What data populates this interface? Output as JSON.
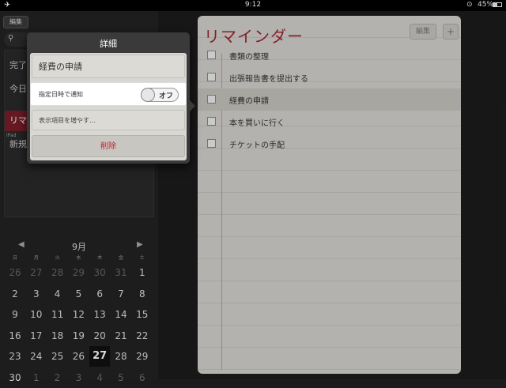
{
  "status_bar": {
    "airplane_icon": "airplane-icon",
    "time": "9:12",
    "battery_percent": "45%",
    "battery_level": 0.45
  },
  "left_pane": {
    "edit_label": "編集",
    "lists": [
      {
        "label": "完了",
        "selected": false
      },
      {
        "label": "今日",
        "selected": false
      },
      {
        "label": "リマ",
        "selected": true
      },
      {
        "label": "新規",
        "selected": false
      }
    ],
    "device_tag": "iPad"
  },
  "calendar": {
    "month": "9月",
    "weekdays": [
      "日",
      "月",
      "火",
      "水",
      "木",
      "金",
      "土"
    ],
    "weeks": [
      [
        "26",
        "27",
        "28",
        "29",
        "30",
        "31",
        "1"
      ],
      [
        "2",
        "3",
        "4",
        "5",
        "6",
        "7",
        "8"
      ],
      [
        "9",
        "10",
        "11",
        "12",
        "13",
        "14",
        "15"
      ],
      [
        "16",
        "17",
        "18",
        "19",
        "20",
        "21",
        "22"
      ],
      [
        "23",
        "24",
        "25",
        "26",
        "27",
        "28",
        "29"
      ],
      [
        "30",
        "1",
        "2",
        "3",
        "4",
        "5",
        "6"
      ]
    ],
    "today": "27"
  },
  "notepad": {
    "title": "リマインダー",
    "edit_label": "編集",
    "add_symbol": "+",
    "tasks": [
      {
        "label": "書類の整理"
      },
      {
        "label": "出張報告書を提出する"
      },
      {
        "label": "経費の申請"
      },
      {
        "label": "本を買いに行く"
      },
      {
        "label": "チケットの手配"
      }
    ]
  },
  "popover": {
    "title": "詳細",
    "item_name": "経費の申請",
    "notify_label": "指定日時で通知",
    "notify_state": "オフ",
    "more_items": "表示項目を増やす...",
    "delete_label": "削除"
  }
}
